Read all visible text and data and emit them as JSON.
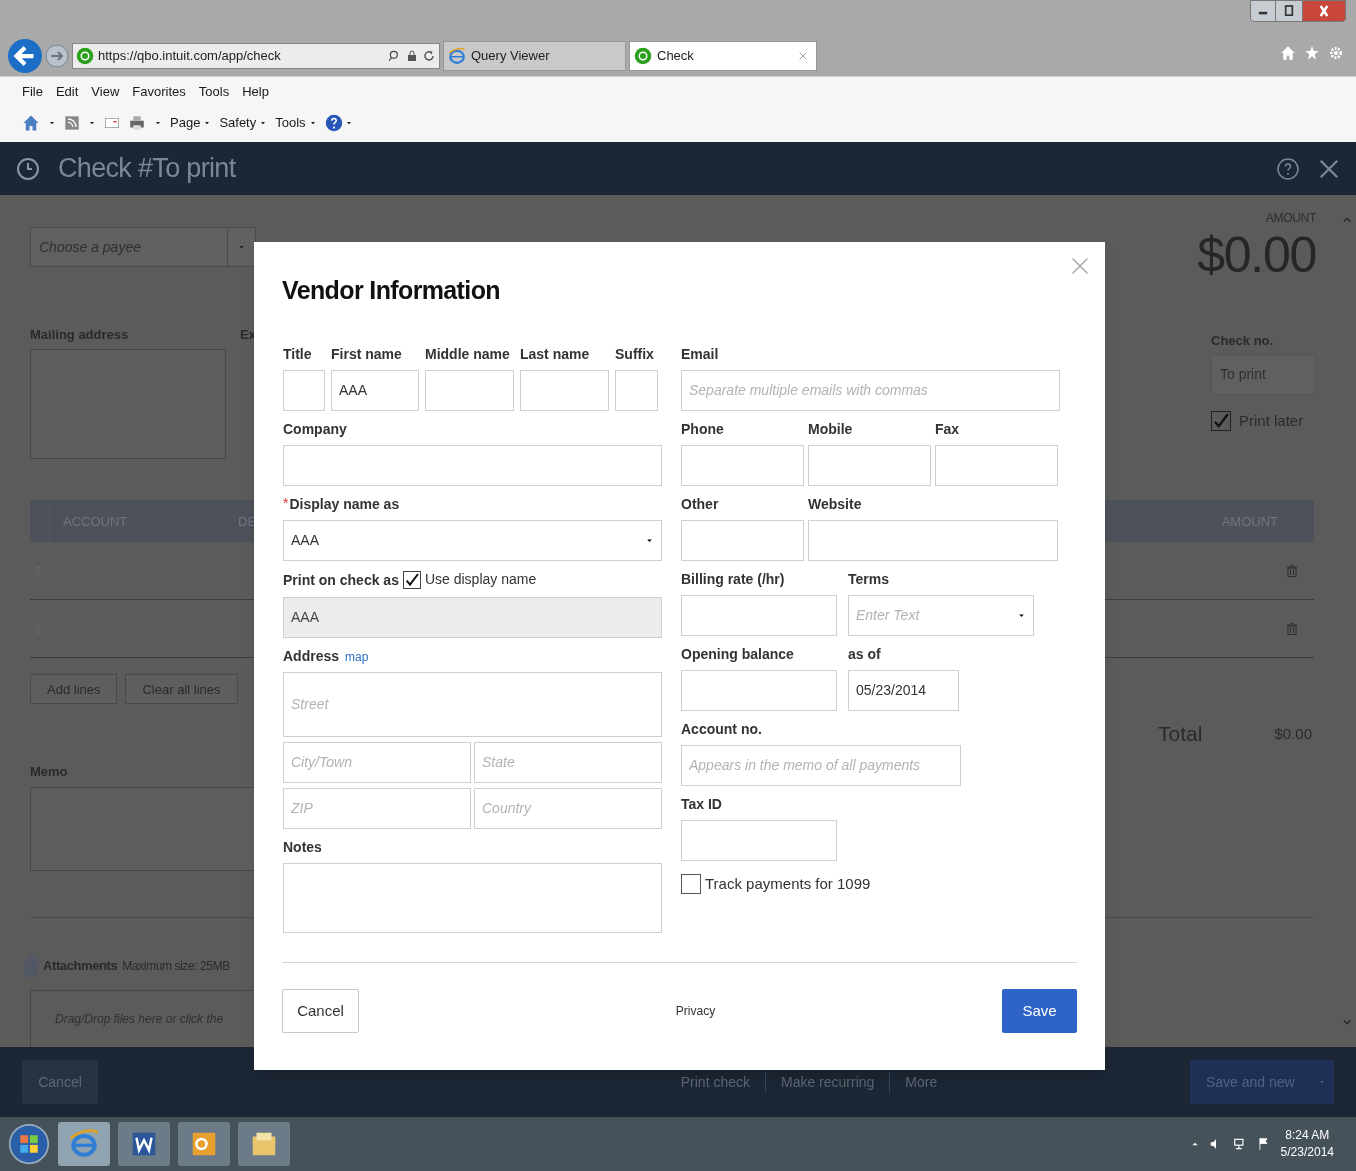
{
  "browser": {
    "address": "https://qbo.intuit.com/app/check",
    "tabs": [
      {
        "label": "Query Viewer",
        "selected": false
      },
      {
        "label": "Check",
        "selected": true
      }
    ],
    "menu": [
      "File",
      "Edit",
      "View",
      "Favorites",
      "Tools",
      "Help"
    ],
    "commands": [
      "Page",
      "Safety",
      "Tools"
    ]
  },
  "page": {
    "title": "Check #To print",
    "payee_placeholder": "Choose a payee",
    "mailing_label": "Mailing address",
    "cut_label": "Ex",
    "amount_label": "AMOUNT",
    "amount": "$0.00",
    "check_no": {
      "label": "Check no.",
      "placeholder": "To print"
    },
    "print_later": {
      "label": "Print later",
      "checked": true
    },
    "columns": [
      "ACCOUNT",
      "DE",
      "AMOUNT"
    ],
    "line_buttons": [
      "Add lines",
      "Clear all lines"
    ],
    "total": {
      "label": "Total",
      "value": "$0.00"
    },
    "memo_label": "Memo",
    "attachments": {
      "label": "Attachments",
      "hint": "Maximum size: 25MB",
      "drop_placeholder": "Drag/Drop files here or click the"
    }
  },
  "footer": {
    "cancel": "Cancel",
    "actions": [
      "Print check",
      "Make recurring",
      "More"
    ],
    "save": "Save and new"
  },
  "taskbar": {
    "time": "8:24 AM",
    "date": "5/23/2014"
  },
  "modal": {
    "title": "Vendor Information",
    "name_fields": [
      {
        "label": "Title"
      },
      {
        "label": "First name",
        "value": "AAA"
      },
      {
        "label": "Middle name"
      },
      {
        "label": "Last name"
      },
      {
        "label": "Suffix"
      }
    ],
    "company": {
      "label": "Company"
    },
    "display_name": {
      "label": "Display name as",
      "required_mark": "*",
      "value": "AAA"
    },
    "print_on_check": {
      "label": "Print on check as",
      "checkbox_label": "Use display name",
      "checked": true,
      "value": "AAA"
    },
    "address": {
      "label": "Address",
      "link": "map",
      "fields": [
        {
          "placeholder": "Street"
        },
        {
          "placeholder": "City/Town"
        },
        {
          "placeholder": "State"
        },
        {
          "placeholder": "ZIP"
        },
        {
          "placeholder": "Country"
        }
      ]
    },
    "notes": {
      "label": "Notes"
    },
    "email": {
      "label": "Email",
      "placeholder": "Separate multiple emails with commas"
    },
    "phones": [
      {
        "label": "Phone"
      },
      {
        "label": "Mobile"
      },
      {
        "label": "Fax"
      }
    ],
    "other": {
      "label": "Other"
    },
    "website": {
      "label": "Website"
    },
    "billing_rate": {
      "label": "Billing rate (/hr)"
    },
    "terms": {
      "label": "Terms",
      "placeholder": "Enter Text"
    },
    "opening_balance": {
      "label": "Opening balance"
    },
    "as_of": {
      "label": "as of",
      "value": "05/23/2014"
    },
    "account_no": {
      "label": "Account no.",
      "placeholder": "Appears in the memo of all payments"
    },
    "tax_id": {
      "label": "Tax ID"
    },
    "track_1099": {
      "label": "Track payments for 1099",
      "checked": false
    },
    "buttons": {
      "cancel": "Cancel",
      "privacy": "Privacy",
      "save": "Save"
    }
  }
}
